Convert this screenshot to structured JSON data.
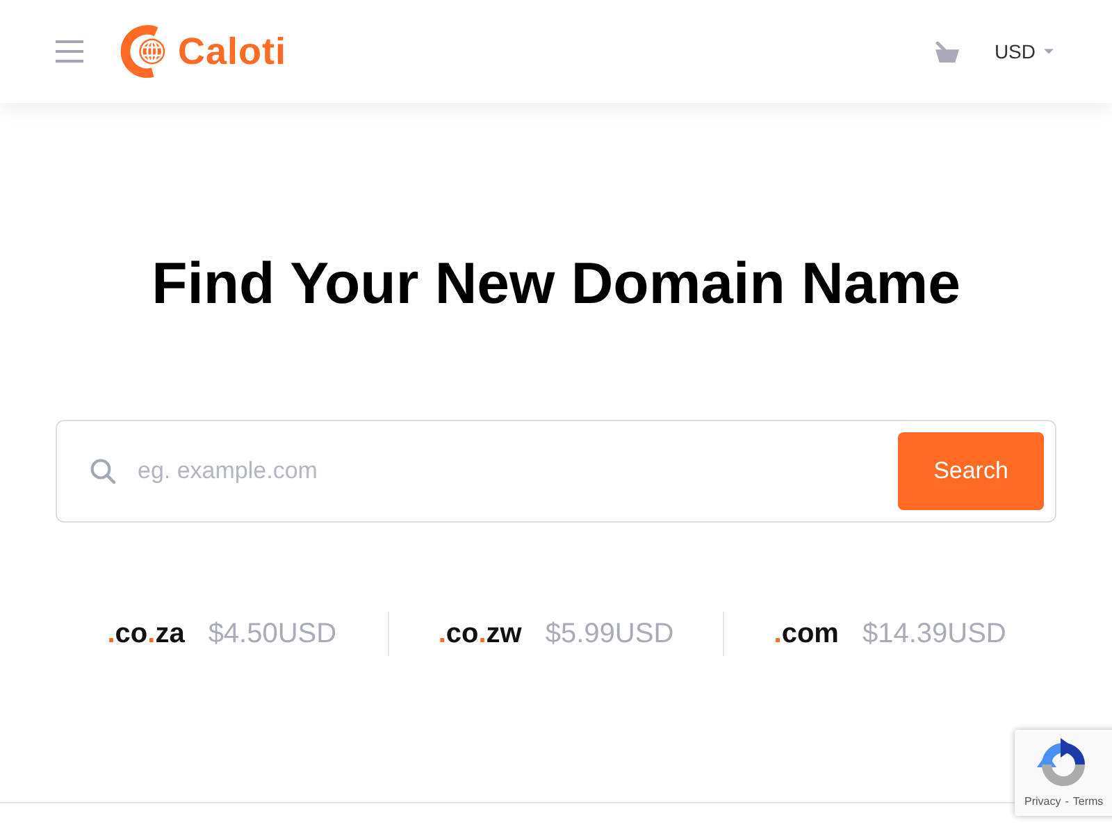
{
  "header": {
    "logo_text": "Caloti",
    "currency": "USD"
  },
  "hero": {
    "title": "Find Your New Domain Name"
  },
  "search": {
    "placeholder": "eg. example.com",
    "button": "Search"
  },
  "tld_prices": [
    {
      "extension": ".co.za",
      "price": "$4.50USD"
    },
    {
      "extension": ".co.zw",
      "price": "$5.99USD"
    },
    {
      "extension": ".com",
      "price": "$14.39USD"
    }
  ],
  "recaptcha": {
    "links": [
      "Privacy",
      "Terms"
    ],
    "separator": "-"
  }
}
